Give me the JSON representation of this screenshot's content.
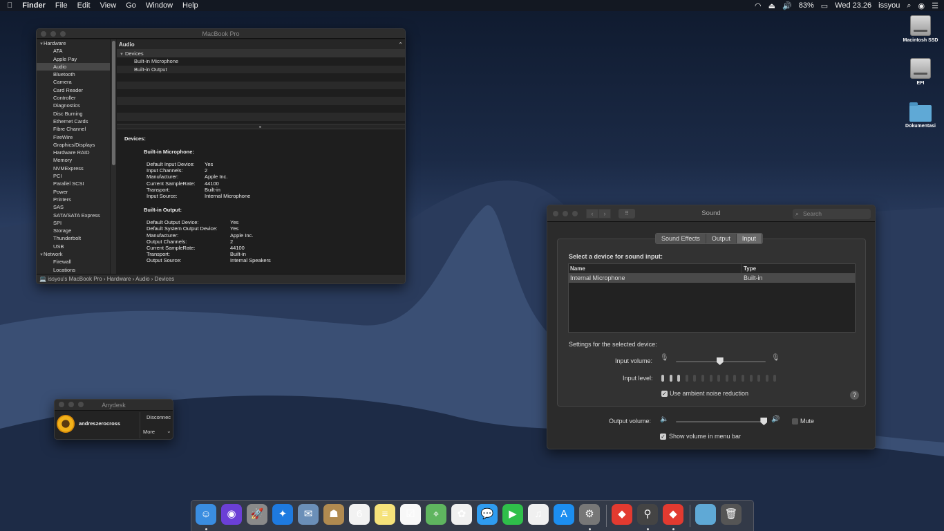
{
  "menubar": {
    "apple": "",
    "items": [
      "Finder",
      "File",
      "Edit",
      "View",
      "Go",
      "Window",
      "Help"
    ],
    "battery": "83%",
    "clock": "Wed 23.26",
    "user": "issyou"
  },
  "desktop_icons": [
    "Macintosh SSD",
    "EFI",
    "Dokumentasi"
  ],
  "sysinfo": {
    "title": "MacBook Pro",
    "sidebar": {
      "groups": [
        "Hardware",
        "Network"
      ],
      "hardware_items": [
        "ATA",
        "Apple Pay",
        "Audio",
        "Bluetooth",
        "Camera",
        "Card Reader",
        "Controller",
        "Diagnostics",
        "Disc Burning",
        "Ethernet Cards",
        "Fibre Channel",
        "FireWire",
        "Graphics/Displays",
        "Hardware RAID",
        "Memory",
        "NVMExpress",
        "PCI",
        "Parallel SCSI",
        "Power",
        "Printers",
        "SAS",
        "SATA/SATA Express",
        "SPI",
        "Storage",
        "Thunderbolt",
        "USB"
      ],
      "network_items": [
        "Firewall",
        "Locations"
      ],
      "selected": "Audio"
    },
    "content_header": "Audio",
    "tree": {
      "devices": "Devices",
      "items": [
        "Built-in Microphone",
        "Built-in Output"
      ]
    },
    "detail": {
      "heading": "Devices:",
      "mic": {
        "title": "Built-in Microphone:",
        "rows": [
          [
            "Default Input Device:",
            "Yes"
          ],
          [
            "Input Channels:",
            "2"
          ],
          [
            "Manufacturer:",
            "Apple Inc."
          ],
          [
            "Current SampleRate:",
            "44100"
          ],
          [
            "Transport:",
            "Built-in"
          ],
          [
            "Input Source:",
            "Internal Microphone"
          ]
        ]
      },
      "out": {
        "title": "Built-in Output:",
        "rows": [
          [
            "Default Output Device:",
            "Yes"
          ],
          [
            "Default System Output Device:",
            "Yes"
          ],
          [
            "Manufacturer:",
            "Apple Inc."
          ],
          [
            "Output Channels:",
            "2"
          ],
          [
            "Current SampleRate:",
            "44100"
          ],
          [
            "Transport:",
            "Built-in"
          ],
          [
            "Output Source:",
            "Internal Speakers"
          ]
        ]
      }
    },
    "pathbar": "issyou's MacBook Pro  ›  Hardware  ›  Audio  ›  Devices"
  },
  "sound": {
    "title": "Sound",
    "search_placeholder": "Search",
    "tabs": [
      "Sound Effects",
      "Output",
      "Input"
    ],
    "selected_tab": "Input",
    "select_label": "Select a device for sound input:",
    "table": {
      "headers": [
        "Name",
        "Type"
      ],
      "rows": [
        [
          "Internal Microphone",
          "Built-in"
        ]
      ]
    },
    "settings_label": "Settings for the selected device:",
    "input_volume_label": "Input volume:",
    "input_volume_fraction": 0.49,
    "input_level_label": "Input level:",
    "input_level_count": 15,
    "input_level_on": 3,
    "ambient_label": "Use ambient noise reduction",
    "ambient_checked": true,
    "output_volume_label": "Output volume:",
    "output_volume_fraction": 0.98,
    "mute_label": "Mute",
    "mute_checked": false,
    "show_volume_label": "Show volume in menu bar",
    "show_volume_checked": true,
    "help": "?"
  },
  "anydesk": {
    "title": "Anydesk",
    "user": "andreszerocross",
    "disconnect": "Disconnec",
    "more": "More"
  },
  "dock": {
    "icons": [
      {
        "name": "finder-icon",
        "glyph": "☺",
        "color": "#3a8de0",
        "running": true
      },
      {
        "name": "siri-icon",
        "glyph": "◉",
        "color": "#6b3fd6",
        "running": false
      },
      {
        "name": "launchpad-icon",
        "glyph": "🚀",
        "color": "#8a8a8a",
        "running": false
      },
      {
        "name": "safari-icon",
        "glyph": "✦",
        "color": "#1e7ae0",
        "running": false
      },
      {
        "name": "mail-icon",
        "glyph": "✉",
        "color": "#6b8fb8",
        "running": false
      },
      {
        "name": "contacts-icon",
        "glyph": "☗",
        "color": "#b08a50",
        "running": false
      },
      {
        "name": "calendar-icon",
        "glyph": "6",
        "color": "#f2f2f2",
        "running": false
      },
      {
        "name": "notes-icon",
        "glyph": "≡",
        "color": "#f5e27a",
        "running": false
      },
      {
        "name": "reminders-icon",
        "glyph": "☑",
        "color": "#f8f8f8",
        "running": false
      },
      {
        "name": "maps-icon",
        "glyph": "⌖",
        "color": "#5fb55f",
        "running": false
      },
      {
        "name": "photos-icon",
        "glyph": "✿",
        "color": "#f0f0f0",
        "running": false
      },
      {
        "name": "messages-icon",
        "glyph": "💬",
        "color": "#2f9cf0",
        "running": false
      },
      {
        "name": "facetime-icon",
        "glyph": "▶",
        "color": "#2fbf4a",
        "running": false
      },
      {
        "name": "itunes-icon",
        "glyph": "♫",
        "color": "#f0f0f0",
        "running": false
      },
      {
        "name": "app-store-icon",
        "glyph": "A",
        "color": "#1c8ef0",
        "running": false
      },
      {
        "name": "system-preferences-icon",
        "glyph": "⚙",
        "color": "#777777",
        "running": true
      },
      {
        "name": "anydesk-icon",
        "glyph": "◆",
        "color": "#e23a30",
        "running": false
      },
      {
        "name": "ios-app-installer-icon",
        "glyph": "⚲",
        "color": "#444444",
        "running": true
      },
      {
        "name": "anydesk-running-icon",
        "glyph": "◆",
        "color": "#e23a30",
        "running": true
      },
      {
        "name": "documents-folder-icon",
        "glyph": "",
        "color": "#5fa9d6",
        "running": false
      },
      {
        "name": "trash-icon",
        "glyph": "🗑",
        "color": "#555555",
        "running": false
      }
    ]
  }
}
